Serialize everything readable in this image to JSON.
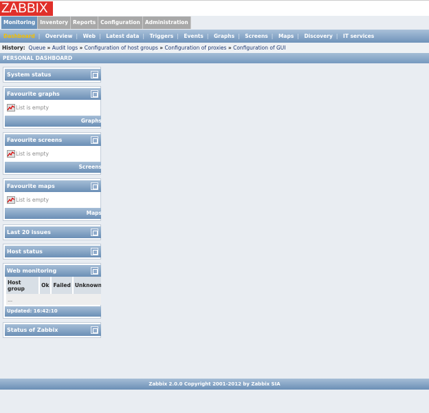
{
  "logo": "ZABBIX",
  "main_tabs": [
    "Monitoring",
    "Inventory",
    "Reports",
    "Configuration",
    "Administration"
  ],
  "sub_menu": [
    "Dashboard",
    "Overview",
    "Web",
    "Latest data",
    "Triggers",
    "Events",
    "Graphs",
    "Screens",
    "Maps",
    "Discovery",
    "IT services"
  ],
  "history": {
    "label": "History:",
    "items": [
      "Queue",
      "Audit logs",
      "Configuration of host groups",
      "Configuration of proxies",
      "Configuration of GUI"
    ],
    "sep": "»"
  },
  "page_title": "PERSONAL DASHBOARD",
  "widgets": {
    "system_status": "System status",
    "fav_graphs": {
      "title": "Favourite graphs",
      "empty": "List is empty",
      "footer": "Graphs"
    },
    "fav_screens": {
      "title": "Favourite screens",
      "empty": "List is empty",
      "footer": "Screens"
    },
    "fav_maps": {
      "title": "Favourite maps",
      "empty": "List is empty",
      "footer": "Maps"
    },
    "last_issues": "Last 20 issues",
    "host_status": "Host status",
    "web": {
      "title": "Web monitoring",
      "columns": [
        "Host group",
        "Ok",
        "Failed",
        "Unknown"
      ],
      "row": "...",
      "updated": "Updated: 16:42:10"
    },
    "status_zabbix": "Status of Zabbix"
  },
  "footer": "Zabbix 2.0.0 Copyright 2001-2012 by Zabbix SIA"
}
